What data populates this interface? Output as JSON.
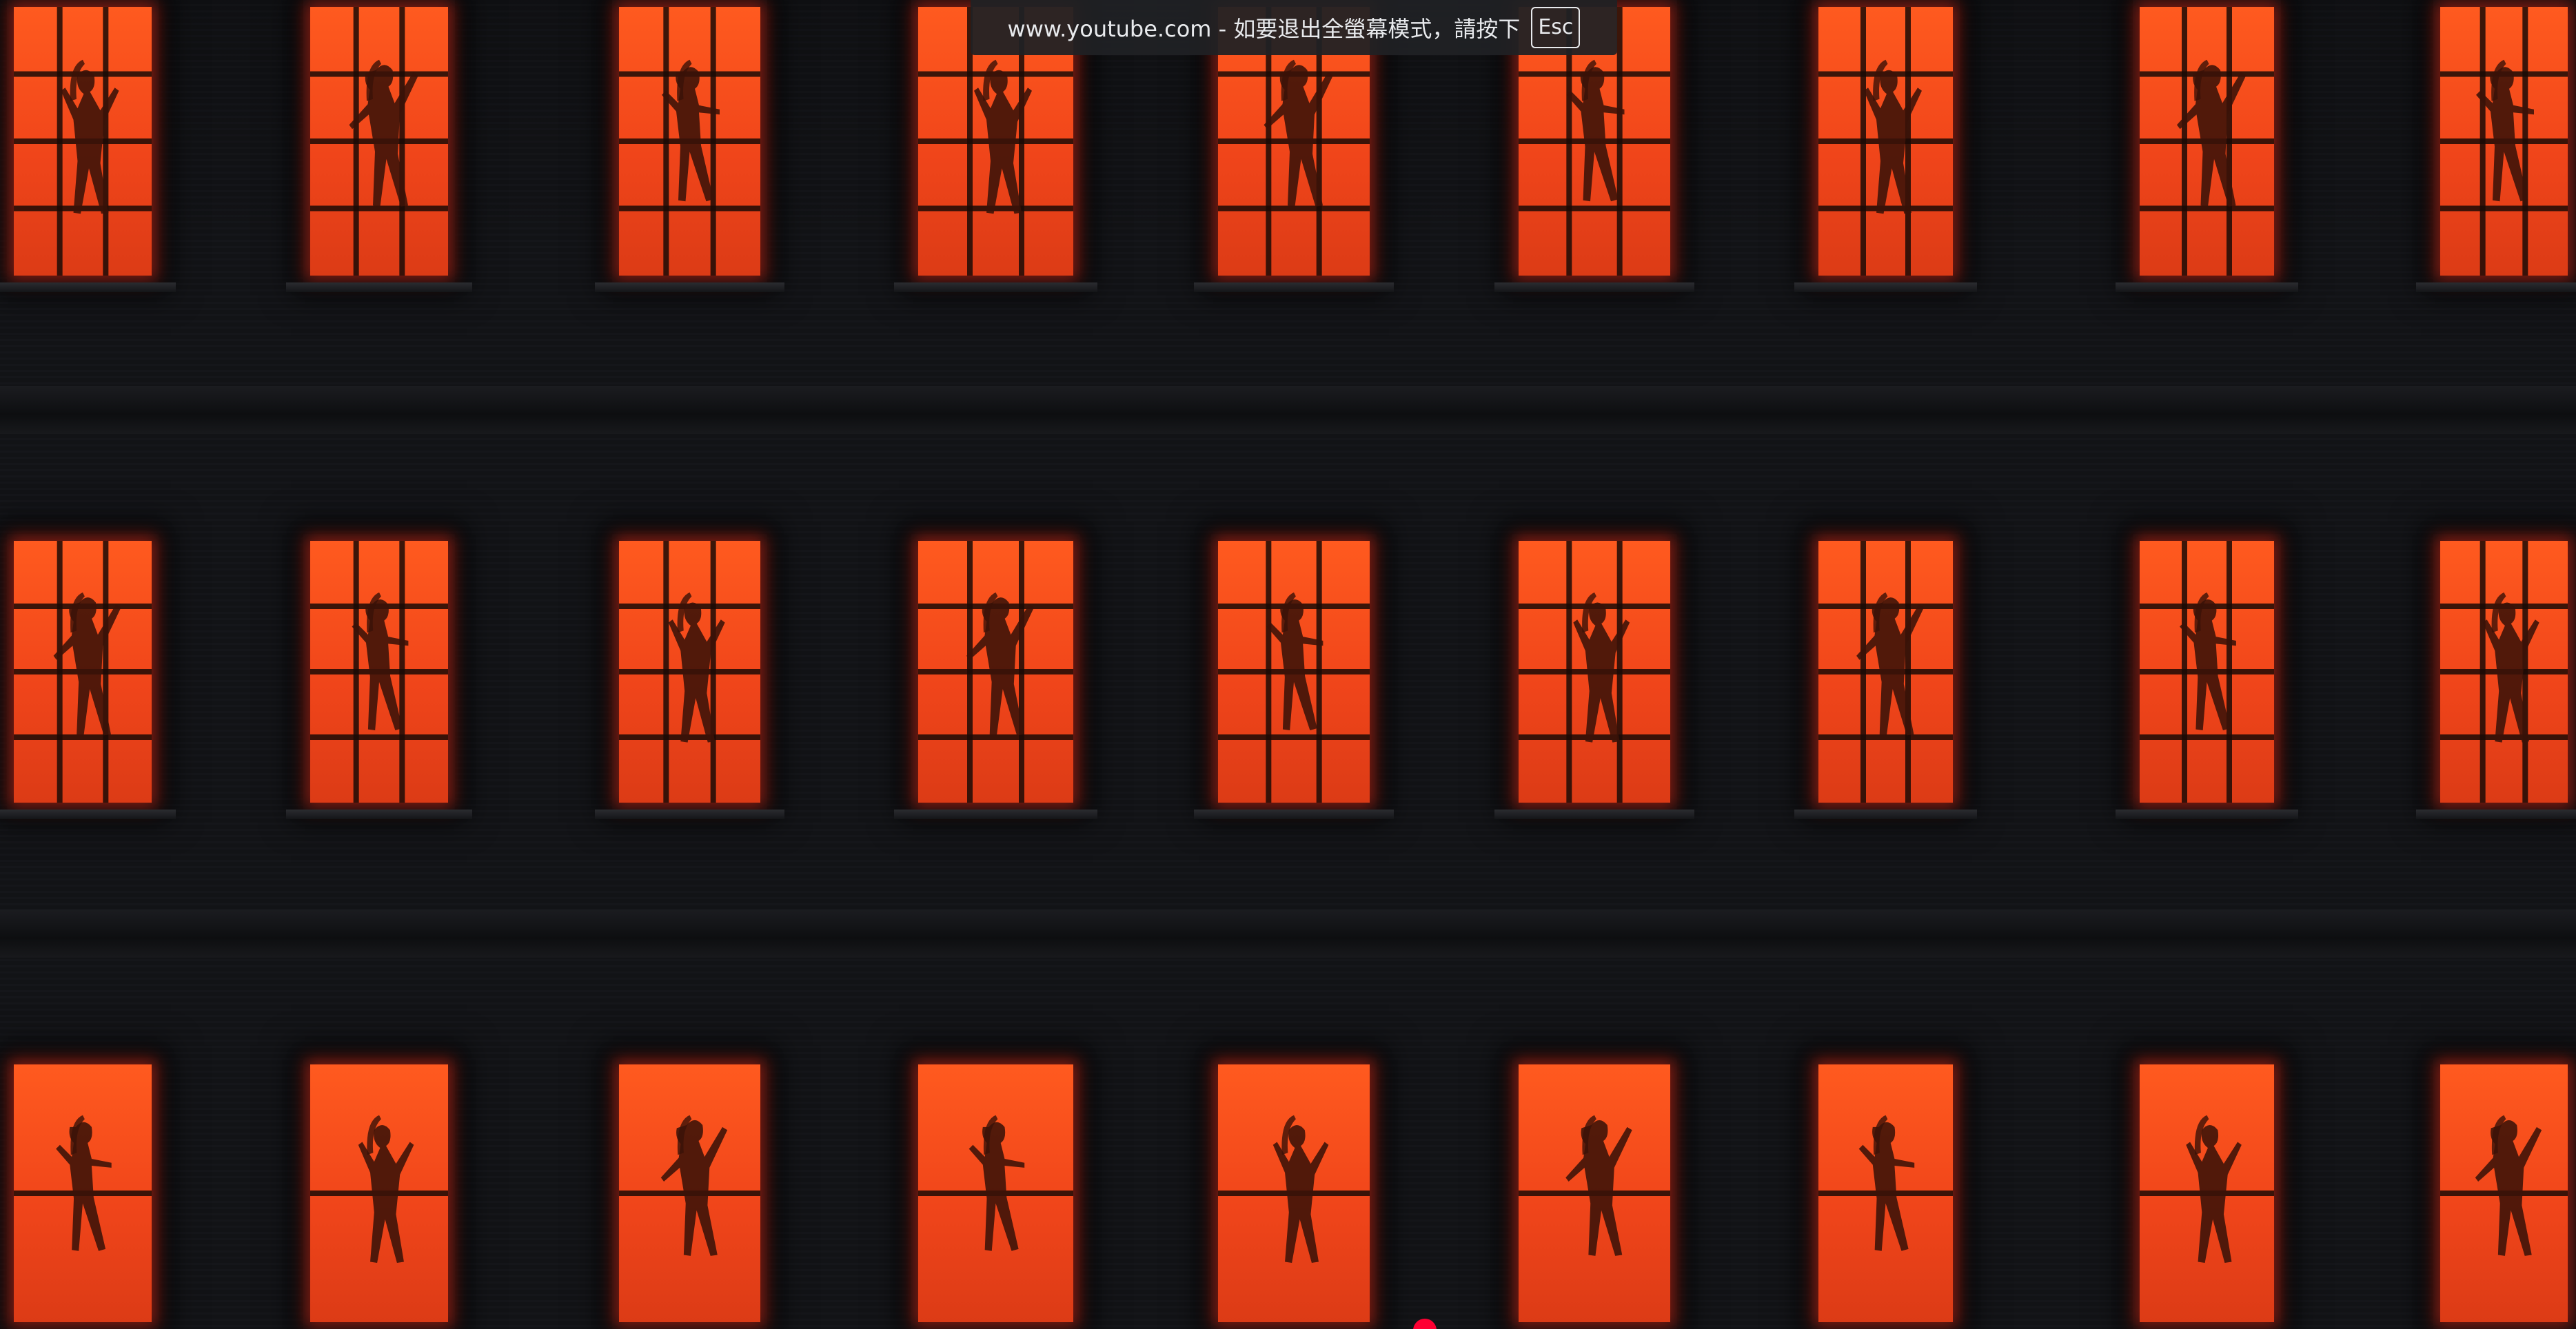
{
  "fullscreen_banner": {
    "message": "www.youtube.com - 如要退出全螢幕模式，請按下",
    "key_label": "Esc"
  },
  "video": {
    "scene": "building-facade-with-lit-windows",
    "window_color": "#f0451a",
    "wall_color": "#131417",
    "progress_color": "#ff0033",
    "rows": 3,
    "columns": 9
  },
  "icons": {
    "progress_scrubber": "red-dot-icon"
  }
}
